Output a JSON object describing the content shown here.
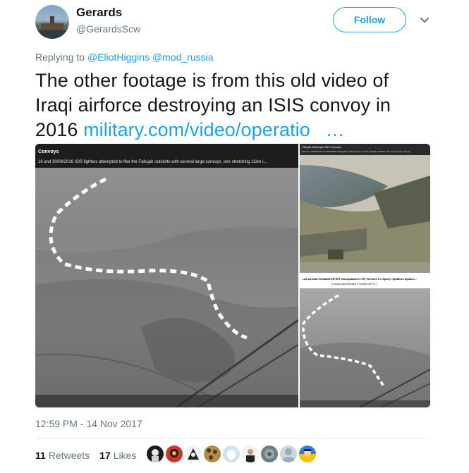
{
  "user": {
    "name": "Gerards",
    "handle": "@GerardsScw"
  },
  "follow_label": "Follow",
  "reply": {
    "prefix": "Replying to",
    "mentions": [
      "@EliotHiggins",
      "@mod_russia"
    ]
  },
  "tweet": {
    "text": "The other footage is from this old video of Iraqi airforce destroying an ISIS convoy in 2016",
    "url": "military.com/video/operatio",
    "ellipsis": "…"
  },
  "media": {
    "left_title": "Convoys",
    "left_caption": "16 and 30/06/2016 ISIS fighters attempted to flee the Fallujah outskirts with several large convoys, one stretching 11km l...",
    "right_top_caption": "Fallujah Destroyed ISIS Convoys",
    "right_top_subcaption": "Between 29/06/2016 and 30/06/2016 ISIS fighters attempted to flee the Fallujah outskirts with several large convoys",
    "right_mid_caption": "...на колонн боевиков ИГИЛ, выходящих из Абу-Кемаль в сторону сирийско-иракск...",
    "right_mid_subcaption": "(съемка произведена 9 ноября 2017 г.)"
  },
  "timestamp": "12:59 PM - 14 Nov 2017",
  "stats": {
    "retweets_count": "11",
    "retweets_label": "Retweets",
    "likes_count": "17",
    "likes_label": "Likes"
  },
  "likers": [
    "liker-1",
    "liker-2",
    "liker-3",
    "liker-4",
    "liker-5",
    "liker-6",
    "liker-7",
    "liker-8",
    "liker-9"
  ],
  "colors": {
    "accent": "#1da1f2",
    "text": "#14171a",
    "muted": "#657786",
    "divider": "#e6ecf0"
  }
}
